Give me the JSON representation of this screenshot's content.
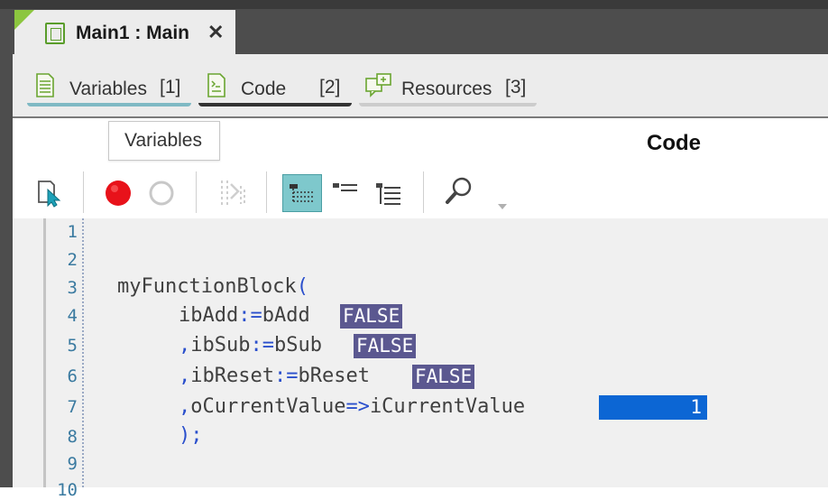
{
  "editor_tab": {
    "title": "Main1 : Main",
    "close": "✕"
  },
  "subtabs": [
    {
      "label": "Variables",
      "shortcut": "[1]",
      "icon": "variables-list-icon",
      "color": "#7fb9c4"
    },
    {
      "label": "Code",
      "shortcut": "[2]",
      "icon": "code-document-icon",
      "color": "#333333"
    },
    {
      "label": "Resources",
      "shortcut": "[3]",
      "icon": "resources-icon",
      "color": "#cccccc"
    }
  ],
  "tooltip": "Variables",
  "code_heading": "Code",
  "toolbar": [
    "select-cursor-icon",
    "record-breakpoint-icon",
    "empty-breakpoint-icon",
    "step-disabled-icon",
    "tree-view-icon",
    "list-indent-icon",
    "list-outdent-icon",
    "search-icon",
    "dropdown-arrow-icon"
  ],
  "line_numbers": [
    "1",
    "2",
    "3",
    "4",
    "5",
    "6",
    "7",
    "8",
    "9",
    "10"
  ],
  "code": {
    "l3_name": "myFunctionBlock",
    "l3_paren": "(",
    "l4_a": "ibAdd",
    "l4_op": ":=",
    "l4_b": "bAdd",
    "l4_val": "FALSE",
    "l5_comma": ",",
    "l5_a": "ibSub",
    "l5_op": ":=",
    "l5_b": "bSub",
    "l5_val": "FALSE",
    "l6_comma": ",",
    "l6_a": "ibReset",
    "l6_op": ":=",
    "l6_b": "bReset",
    "l6_val": "FALSE",
    "l7_comma": ",",
    "l7_a": "oCurrentValue",
    "l7_op": "=>",
    "l7_b": "iCurrentValue",
    "l7_val": "1",
    "l8_close": ");"
  },
  "colors": {
    "accent_green": "#8cc63f",
    "value_badge": "#5b5890",
    "value_selected": "#0c66d4",
    "keyword_symbol": "#2a4fcc"
  }
}
